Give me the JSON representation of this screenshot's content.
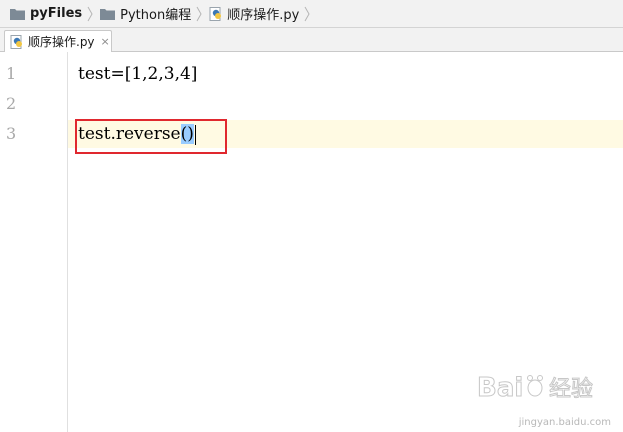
{
  "breadcrumb": {
    "items": [
      {
        "label": "pyFiles",
        "icon": "folder-icon"
      },
      {
        "label": "Python编程",
        "icon": "folder-icon"
      },
      {
        "label": "顺序操作.py",
        "icon": "python-file-icon"
      }
    ]
  },
  "tabs": [
    {
      "label": "顺序操作.py",
      "icon": "python-file-icon",
      "close": "×",
      "active": true
    }
  ],
  "editor": {
    "line_numbers": [
      "1",
      "2",
      "3"
    ],
    "lines": [
      "test=[1,2,3,4]",
      "",
      "test.reverse()"
    ],
    "line3_prefix": "test.reverse",
    "line3_parens": "()",
    "current_line": 3
  },
  "watermark": {
    "logo_text": "Bai",
    "logo_text_suffix": "经验",
    "url": "jingyan.baidu.com"
  },
  "colors": {
    "current_line_bg": "#fffae3",
    "paren_highlight": "#99ccff",
    "annotation_box": "#e0282e",
    "line_number": "#a8a8a8"
  }
}
